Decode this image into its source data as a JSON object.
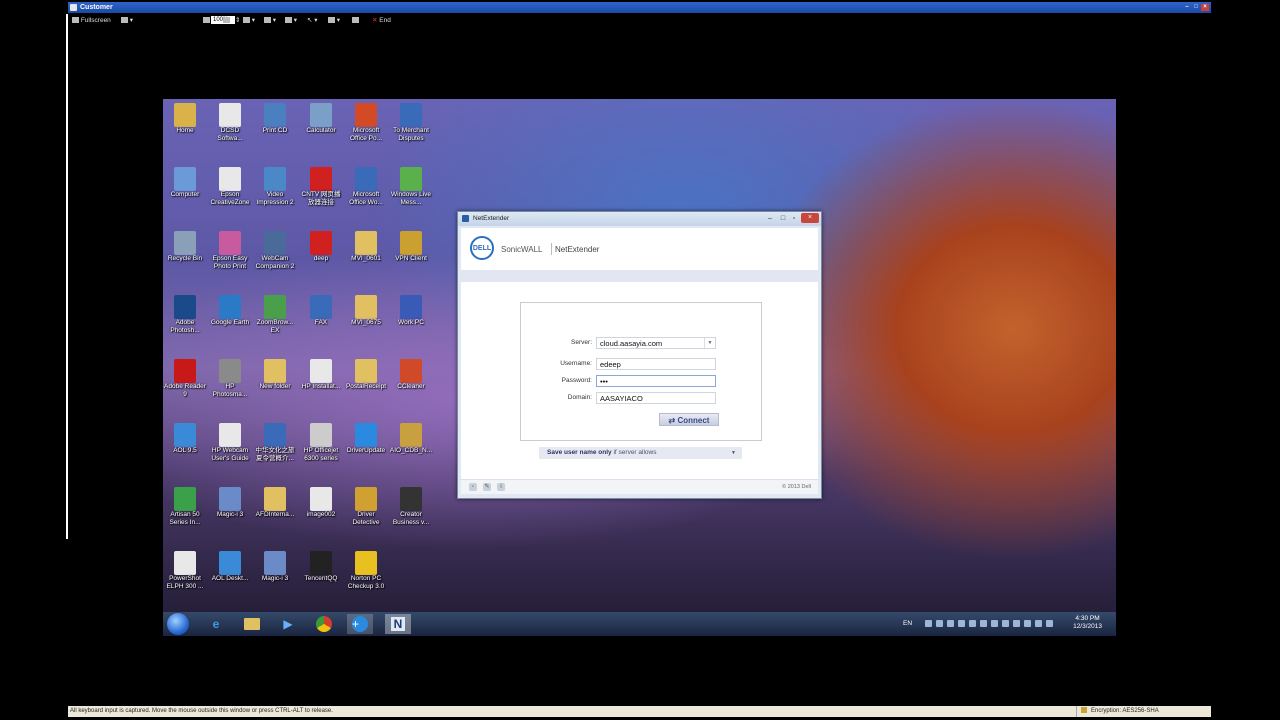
{
  "window": {
    "title": "Customer"
  },
  "toolbar": {
    "fullscreen_label": "Fullscreen",
    "zoom_value": "100%",
    "end_label": "End"
  },
  "desktop": {
    "icons": [
      {
        "label": "Home",
        "color": "#d9b24a"
      },
      {
        "label": "DCSD Softwa...",
        "color": "#e8e8e8"
      },
      {
        "label": "Print CD",
        "color": "#4a7fc0"
      },
      {
        "label": "Calculator",
        "color": "#7aa0c8"
      },
      {
        "label": "Microsoft Office Po...",
        "color": "#d24a26"
      },
      {
        "label": "To Merchant Disputes",
        "color": "#3a6bb8"
      },
      {
        "label": "Computer",
        "color": "#6a9ad8"
      },
      {
        "label": "Epson CreativeZone",
        "color": "#e8e8e8"
      },
      {
        "label": "Video Impression 2",
        "color": "#4a88c8"
      },
      {
        "label": "CNTV 网页播放器连接",
        "color": "#d02020"
      },
      {
        "label": "Microsoft Office Wo...",
        "color": "#3a6bb8"
      },
      {
        "label": "Windows Live Mess...",
        "color": "#5ab04a"
      },
      {
        "label": "Recycle Bin",
        "color": "#8aa0b8"
      },
      {
        "label": "Epson Easy Photo Print",
        "color": "#c85aa0"
      },
      {
        "label": "WebCam Companion 2",
        "color": "#4a6a9a"
      },
      {
        "label": "deep",
        "color": "#d02020"
      },
      {
        "label": "MVI_0601",
        "color": "#e0c060"
      },
      {
        "label": "VPN Client",
        "color": "#caa030"
      },
      {
        "label": "Adobe Photosh...",
        "color": "#1a4a8a"
      },
      {
        "label": "Google Earth",
        "color": "#2a7ac8"
      },
      {
        "label": "ZoomBrow... EX",
        "color": "#4aa04a"
      },
      {
        "label": "FAX",
        "color": "#3a6bb8"
      },
      {
        "label": "MVI_0675",
        "color": "#e0c060"
      },
      {
        "label": "Work PC",
        "color": "#3a5ab8"
      },
      {
        "label": "Adobe Reader 9",
        "color": "#c81818"
      },
      {
        "label": "HP Photosma...",
        "color": "#8a8a8a"
      },
      {
        "label": "New folder",
        "color": "#e0c060"
      },
      {
        "label": "HP Installat...",
        "color": "#e8e8e8"
      },
      {
        "label": "PostalReceipt",
        "color": "#e0c060"
      },
      {
        "label": "CCleaner",
        "color": "#d04a2a"
      },
      {
        "label": "AOL 9.5",
        "color": "#3a8ad8"
      },
      {
        "label": "HP Webcam User's Guide",
        "color": "#e8e8e8"
      },
      {
        "label": "中华文化之旅 夏令营概介...",
        "color": "#3a6bb8"
      },
      {
        "label": "HP Officejet 6300 series",
        "color": "#cccccc"
      },
      {
        "label": "DriverUpdate",
        "color": "#2a8ae0"
      },
      {
        "label": "AIO_CDB_N...",
        "color": "#c8a040"
      },
      {
        "label": "Artisan 50 Series In...",
        "color": "#3aa04a"
      },
      {
        "label": "Magic-i 3",
        "color": "#6a8ac8"
      },
      {
        "label": "AFDInterna...",
        "color": "#e0c060"
      },
      {
        "label": "image002",
        "color": "#e8e8e8"
      },
      {
        "label": "Driver Detective",
        "color": "#d0a030"
      },
      {
        "label": "Creator Business v...",
        "color": "#333333"
      },
      {
        "label": "PowerShot ELPH 300 ...",
        "color": "#e8e8e8"
      },
      {
        "label": "AOL Deskt...",
        "color": "#3a8ad8"
      },
      {
        "label": "Magic-i 3",
        "color": "#6a8ac8"
      },
      {
        "label": "TencentQQ",
        "color": "#222222"
      },
      {
        "label": "Norton PC Checkup 3.0",
        "color": "#e8c020"
      }
    ]
  },
  "taskbar": {
    "lang": "EN",
    "time": "4:30 PM",
    "date": "12/3/2013"
  },
  "netextender": {
    "title": "NetExtender",
    "logo_text": "DELL",
    "brand": "SonicWALL",
    "product": "NetExtender",
    "server_label": "Server:",
    "server_value": "cloud.aasayia.com",
    "username_label": "Username:",
    "username_value": "edeep",
    "password_label": "Password:",
    "password_value": "•••",
    "domain_label": "Domain:",
    "domain_value": "AASAYIACO",
    "connect_label": "Connect",
    "save_bold": "Save user name only",
    "save_rest": "if server allows",
    "copyright": "© 2013 Dell"
  },
  "statusbar": {
    "message": "All keyboard input is captured. Move the mouse outside this window or press CTRL-ALT to release.",
    "encryption": "Encryption: AES256-SHA"
  }
}
